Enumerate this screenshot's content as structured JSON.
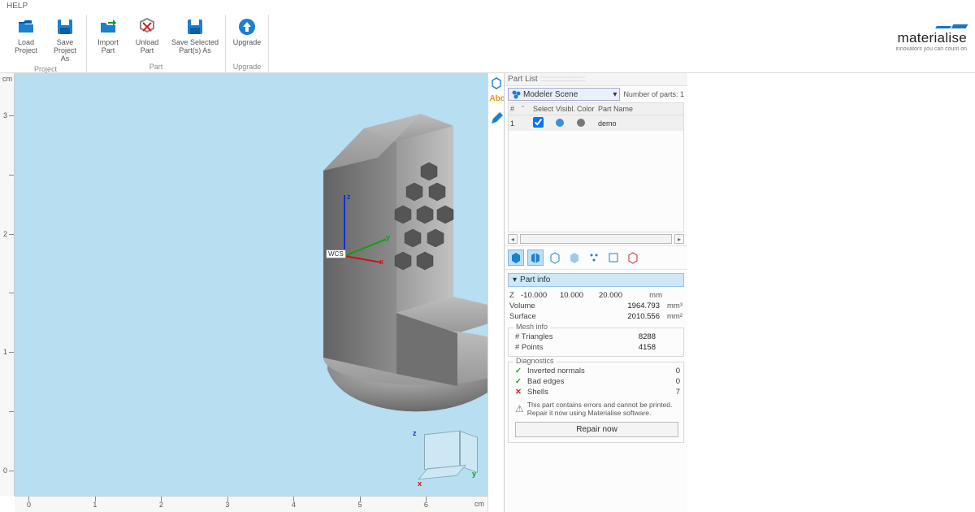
{
  "menu": {
    "help": "HELP"
  },
  "ribbon": {
    "groups": [
      {
        "caption": "Project",
        "buttons": [
          {
            "name": "load-project",
            "label": "Load\nProject"
          },
          {
            "name": "save-project-as",
            "label": "Save Project\nAs"
          }
        ]
      },
      {
        "caption": "Part",
        "buttons": [
          {
            "name": "import-part",
            "label": "Import\nPart"
          },
          {
            "name": "unload-part",
            "label": "Unload\nPart"
          },
          {
            "name": "save-selected-parts-as",
            "label": "Save Selected\nPart(s) As",
            "wide": true
          }
        ]
      },
      {
        "caption": "Upgrade",
        "buttons": [
          {
            "name": "upgrade",
            "label": "Upgrade"
          }
        ]
      }
    ]
  },
  "brand": {
    "name": "materialise",
    "tagline": "innovators you can count on"
  },
  "rulers": {
    "unit": "cm",
    "v_labels": [
      "3",
      "2",
      "1",
      "0"
    ],
    "h_labels": [
      "0",
      "1",
      "2",
      "3",
      "4",
      "5",
      "6"
    ]
  },
  "axes": {
    "x": "x",
    "y": "y",
    "z": "z",
    "wcs": "WCS"
  },
  "part_list": {
    "title": "Part List",
    "scene": "Modeler Scene",
    "count_label": "Number of parts:",
    "count": "1",
    "headers": {
      "idx": "#",
      "up": "ˆ",
      "select": "Select",
      "visible": "Visibl.",
      "color": "Color",
      "name": "Part Name"
    },
    "rows": [
      {
        "idx": "1",
        "selected": true,
        "visible_color": "#3a8fd8",
        "color": "#777777",
        "name": "demo"
      }
    ]
  },
  "part_info": {
    "header": "Part info",
    "z_row": {
      "label": "Z",
      "min": "-10.000",
      "max": "10.000",
      "range": "20.000",
      "unit": "mm"
    },
    "volume": {
      "label": "Volume",
      "value": "1964.793",
      "unit": "mm³"
    },
    "surface": {
      "label": "Surface",
      "value": "2010.556",
      "unit": "mm²"
    }
  },
  "mesh_info": {
    "legend": "Mesh info",
    "triangles": {
      "label": "# Triangles",
      "value": "8288"
    },
    "points": {
      "label": "# Points",
      "value": "4158"
    }
  },
  "diagnostics": {
    "legend": "Diagnostics",
    "items": [
      {
        "status": "ok",
        "label": "Inverted normals",
        "value": "0"
      },
      {
        "status": "ok",
        "label": "Bad edges",
        "value": "0"
      },
      {
        "status": "bad",
        "label": "Shells",
        "value": "7"
      }
    ],
    "message": "This part contains errors and cannot be printed. Repair it now using Materialise software.",
    "repair": "Repair now"
  }
}
